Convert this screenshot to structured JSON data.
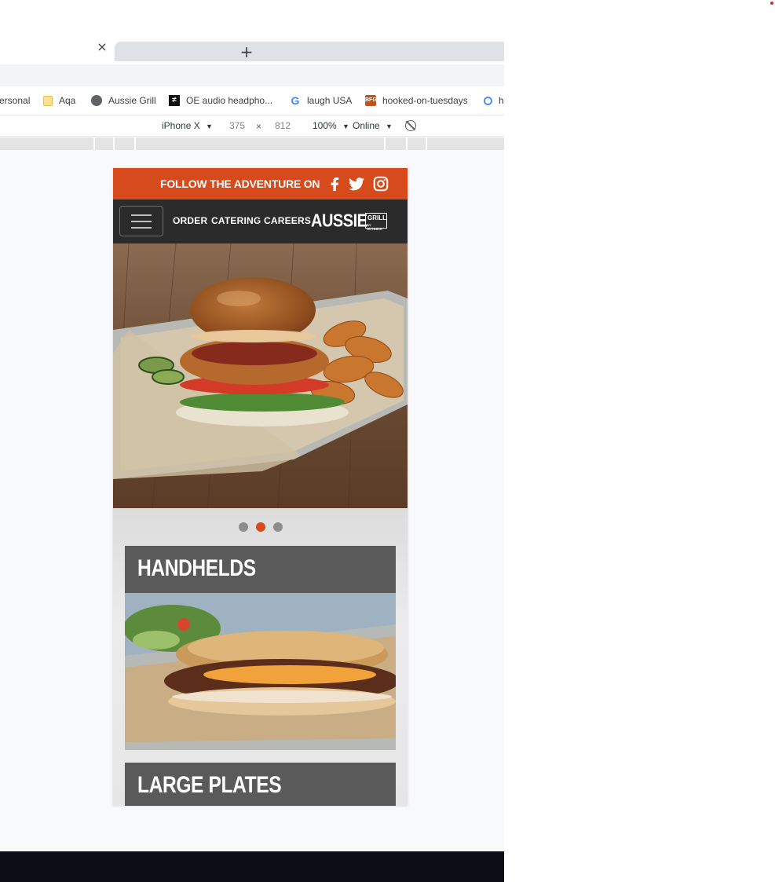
{
  "tab_bar": {
    "close_glyph": "×",
    "new_tab_glyph": "+"
  },
  "bookmarks": [
    {
      "label": "ersonal",
      "icon": "folder-icon"
    },
    {
      "label": "Aqa",
      "icon": "folder-icon"
    },
    {
      "label": "Aussie Grill",
      "icon": "globe-icon"
    },
    {
      "label": "OE audio headpho...",
      "icon": "oe-icon"
    },
    {
      "label": "laugh USA",
      "icon": "google-icon"
    },
    {
      "label": "hooked-on-tuesdays",
      "icon": "bfg-icon"
    },
    {
      "label": "h",
      "icon": "search-icon"
    }
  ],
  "device_toolbar": {
    "device": "iPhone X",
    "width": "375",
    "times": "×",
    "height": "812",
    "zoom": "100%",
    "network": "Online",
    "dropdown_glyph": "▼"
  },
  "site": {
    "follow_text": "FOLLOW THE ADVENTURE ON",
    "social": [
      "facebook-icon",
      "twitter-icon",
      "instagram-icon"
    ],
    "nav_links": [
      "ORDER",
      "CATERING",
      "CAREERS"
    ],
    "logo_main": "AUSSIE",
    "logo_side": "GRILL",
    "logo_sub": "BY OUTBACK",
    "carousel_dots": 3,
    "carousel_active_index": 1,
    "categories": [
      "HANDHELDS",
      "LARGE PLATES"
    ]
  },
  "colors": {
    "accent": "#d74a1c",
    "nav_bg": "#2b2b2b",
    "card_bg": "#5a5a5a"
  }
}
